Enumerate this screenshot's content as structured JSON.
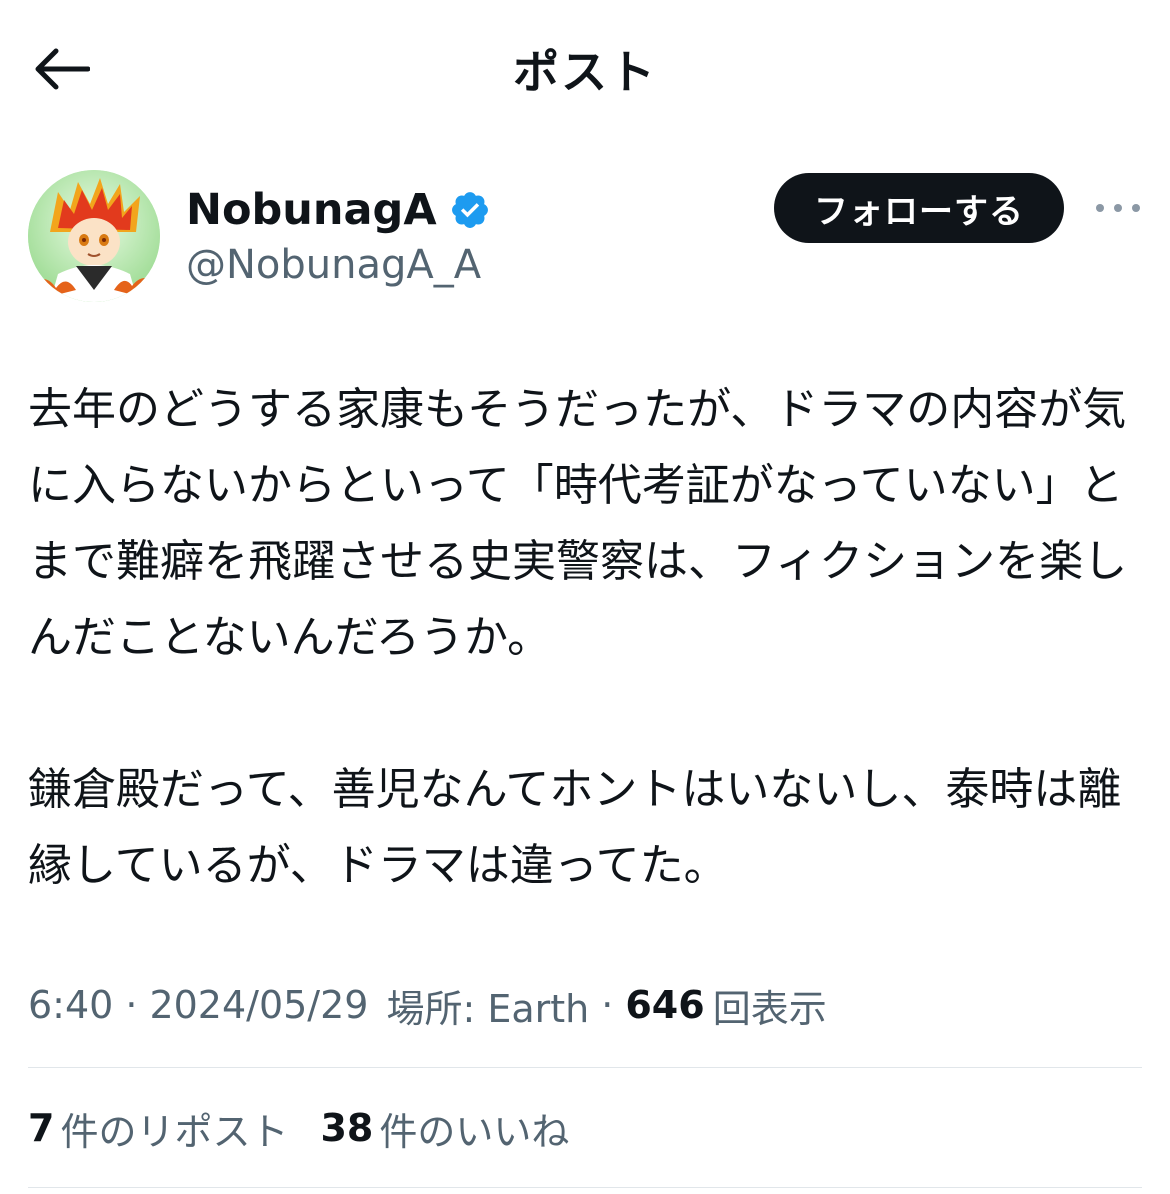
{
  "header": {
    "title": "ポスト",
    "back_icon": "arrow-left-icon"
  },
  "author": {
    "display_name": "NobunagA",
    "handle": "@NobunagA_A",
    "verified": true,
    "verified_icon": "verified-badge-icon",
    "follow_label": "フォローする",
    "more_icon": "more-dots-icon"
  },
  "post": {
    "text": "去年のどうする家康もそうだったが、ドラマの内容が気に入らないからといって「時代考証がなっていない」とまで難癖を飛躍させる史実警察は、フィクションを楽しんだことないんだろうか。\n\n鎌倉殿だって、善児なんてホントはいないし、泰時は離縁しているが、ドラマは違ってた。"
  },
  "meta": {
    "time": "6:40",
    "separator": "·",
    "date": "2024/05/29",
    "location": "場所: Earth",
    "views_count": "646",
    "views_label": "回表示"
  },
  "stats": {
    "reposts_count": "7",
    "reposts_label": "件のリポスト",
    "likes_count": "38",
    "likes_label": "件のいいね"
  },
  "colors": {
    "text_primary": "#0f1419",
    "text_secondary": "#536471",
    "verified_blue": "#1d9bf0",
    "divider": "#e1e6ea",
    "button_bg": "#0f1419"
  }
}
